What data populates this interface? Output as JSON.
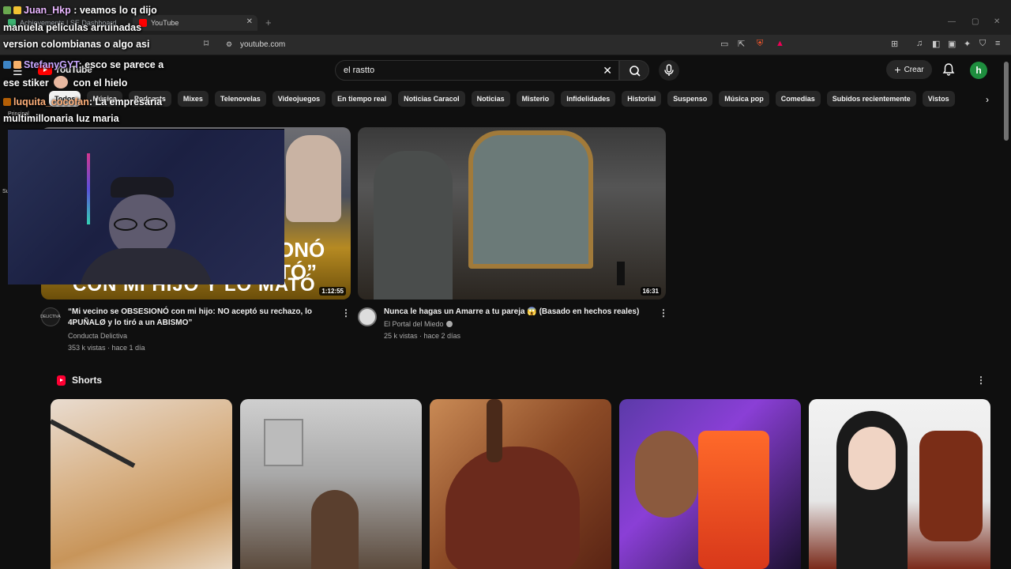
{
  "browser": {
    "tabs": [
      {
        "label": "Achievements | SE Dashboard",
        "active": false
      },
      {
        "label": "YouTube",
        "active": true
      }
    ],
    "url": "youtube.com",
    "accent_color": "#2b2b2b"
  },
  "header": {
    "logo_text": "YouTube",
    "search_query": "el rastto",
    "create_label": "Crear",
    "avatar_letter": "h",
    "avatar_color": "#1e8e3e"
  },
  "sidebar": {
    "items": [
      {
        "label": "Principal"
      },
      {
        "label": "Su"
      }
    ]
  },
  "chips": [
    "Todos",
    "Música",
    "Podcasts",
    "Mixes",
    "Telenovelas",
    "Videojuegos",
    "En tiempo real",
    "Noticias Caracol",
    "Noticias",
    "Misterio",
    "Infidelidades",
    "Historial",
    "Suspenso",
    "Música pop",
    "Comedias",
    "Subidos recientemente",
    "Vistos"
  ],
  "videos": [
    {
      "title_line1": "“Mi vecino se OBSESIONÓ con mi hijo: NO aceptó su rechazo, lo",
      "title_line2": "4PUÑALØ y lo tiró a un ABISMO”",
      "channel": "Conducta Delictiva",
      "stats": "353 k vistas · hace 1 día",
      "duration": "1:12:55",
      "thumb_text_1": "ONÓ",
      "thumb_text_2": "TÓ”",
      "thumb_text_3": "CON MI HIJO Y LO MATÓ",
      "avatar_text": "DELICTIVA"
    },
    {
      "title": "Nunca le hagas un Amarre a tu pareja 😱 (Basado en hechos reales)",
      "channel": "El Portal del Miedo",
      "stats": "25 k vistas · hace 2 días",
      "duration": "16:31"
    }
  ],
  "shorts": {
    "title": "Shorts"
  },
  "chat": [
    {
      "user": "Juan_Hkp",
      "message": " : veamos lo q dijo"
    },
    {
      "message": "manuela peliculas arruinadas"
    },
    {
      "message": "version colombianas o algo asi"
    },
    {
      "user": "StefanyGYT",
      "message": ": esco se parece a"
    },
    {
      "message_a": "ese stiker",
      "message_b": "con el hielo"
    },
    {
      "user": "luquita_cocofan",
      "message": ": La empresaria"
    },
    {
      "message": "multimillonaria luz maria"
    }
  ]
}
